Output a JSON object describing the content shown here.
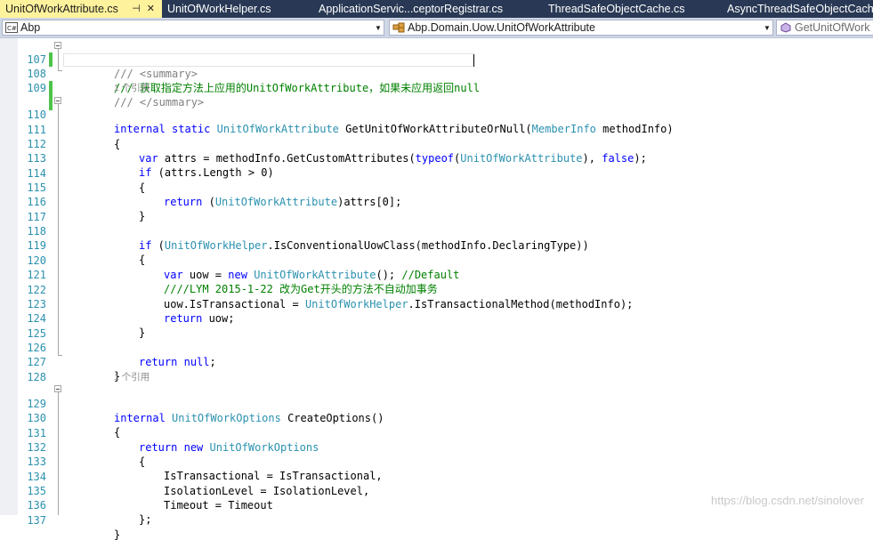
{
  "tabs": [
    {
      "label": "UnitOfWorkAttribute.cs",
      "pin": "⊣",
      "close": "✕",
      "active": true
    },
    {
      "label": "UnitOfWorkHelper.cs"
    },
    {
      "label": "ApplicationServic...ceptorRegistrar.cs"
    },
    {
      "label": "ThreadSafeObjectCache.cs"
    },
    {
      "label": "AsyncThreadSafeObjectCach"
    }
  ],
  "nav": {
    "project": "Abp",
    "type": "Abp.Domain.Uow.UnitOfWorkAttribute",
    "member": "GetUnitOfWork"
  },
  "lens": {
    "ref1": "1 个引用",
    "ref2": "1 个引用"
  },
  "line_numbers": [
    "107",
    "108",
    "109",
    "110",
    "111",
    "112",
    "113",
    "114",
    "115",
    "116",
    "117",
    "118",
    "119",
    "120",
    "121",
    "122",
    "123",
    "124",
    "125",
    "126",
    "127",
    "128",
    "129",
    "130",
    "131",
    "132",
    "133",
    "134",
    "135",
    "136",
    "137"
  ],
  "code": {
    "l107": "/// <summary>",
    "l108": "/// 获取指定方法上应用的UnitOfWorkAttribute，如果未应用返回null",
    "l109": "/// </summary>",
    "l110_kw1": "internal",
    "l110_kw2": "static",
    "l110_ty": "UnitOfWorkAttribute",
    "l110_name": "GetUnitOfWorkAttributeOrNull(",
    "l110_ty2": "MemberInfo",
    "l110_rest": " methodInfo)",
    "l111": "{",
    "l112_var": "var",
    "l112_a": " attrs = methodInfo.GetCustomAttributes(",
    "l112_typeof": "typeof",
    "l112_b": "(",
    "l112_ty": "UnitOfWorkAttribute",
    "l112_c": "), ",
    "l112_false": "false",
    "l112_d": ");",
    "l113_if": "if",
    "l113_rest": " (attrs.Length > 0)",
    "l114": "{",
    "l115_ret": "return",
    "l115_a": " (",
    "l115_ty": "UnitOfWorkAttribute",
    "l115_b": ")attrs[0];",
    "l116": "}",
    "l118_if": "if",
    "l118_a": " (",
    "l118_ty": "UnitOfWorkHelper",
    "l118_b": ".IsConventionalUowClass(methodInfo.DeclaringType))",
    "l119": "{",
    "l120_var": "var",
    "l120_a": " uow = ",
    "l120_new": "new",
    "l120_sp": " ",
    "l120_ty": "UnitOfWorkAttribute",
    "l120_b": "(); ",
    "l120_cm": "//Default",
    "l121_cm": "////LYM 2015-1-22 改为Get开头的方法不自动加事务",
    "l122_a": "uow.IsTransactional = ",
    "l122_ty": "UnitOfWorkHelper",
    "l122_b": ".IsTransactionalMethod(methodInfo);",
    "l123_ret": "return",
    "l123_a": " uow;",
    "l124": "}",
    "l126_ret": "return",
    "l126_sp": " ",
    "l126_null": "null",
    "l126_a": ";",
    "l127": "}",
    "l129_kw": "internal",
    "l129_sp": " ",
    "l129_ty": "UnitOfWorkOptions",
    "l129_a": " CreateOptions()",
    "l130": "{",
    "l131_ret": "return",
    "l131_sp": " ",
    "l131_new": "new",
    "l131_sp2": " ",
    "l131_ty": "UnitOfWorkOptions",
    "l132": "{",
    "l133": "IsTransactional = IsTransactional,",
    "l134": "IsolationLevel = IsolationLevel,",
    "l135": "Timeout = Timeout",
    "l136": "};",
    "l137": "}"
  },
  "watermark": "https://blog.csdn.net/sinolover"
}
